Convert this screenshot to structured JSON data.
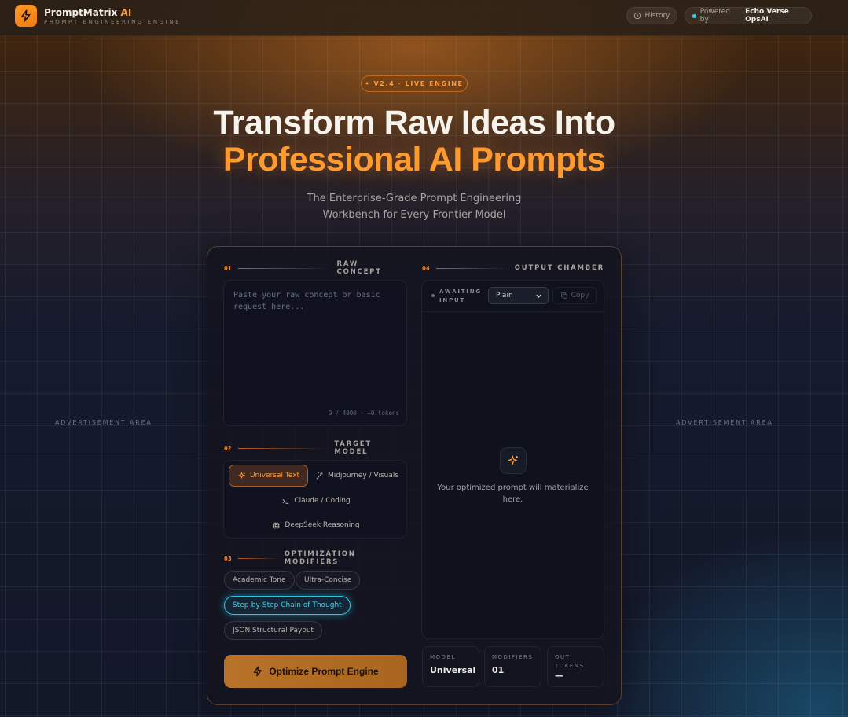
{
  "header": {
    "brand_main": "PromptMatrix",
    "brand_accent": "AI",
    "tagline": "PROMPT ENGINEERING ENGINE",
    "history_label": "History",
    "powered_prefix": "Powered by",
    "powered_name": "Echo Verse OpsAI"
  },
  "hero": {
    "badge": "• V2.4 · LIVE ENGINE",
    "title_line1": "Transform Raw Ideas Into",
    "title_line2": "Professional AI Prompts",
    "subtitle_line1": "The Enterprise-Grade Prompt Engineering",
    "subtitle_line2": "Workbench for Every Frontier Model"
  },
  "ads": {
    "left": "ADVERTISEMENT AREA",
    "right": "ADVERTISEMENT AREA"
  },
  "sections": {
    "s1_num": "01",
    "s1_label": "RAW CONCEPT",
    "s2_num": "02",
    "s2_label": "TARGET MODEL",
    "s3_num": "03",
    "s3_label": "OPTIMIZATION MODIFIERS",
    "s4_num": "04",
    "s4_label": "OUTPUT CHAMBER"
  },
  "concept": {
    "value": "",
    "placeholder": "Paste your raw concept or basic request here...",
    "counter": "0 / 4000 · ~0 tokens"
  },
  "models": [
    {
      "label": "Universal Text",
      "icon": "sparkles-icon",
      "active": true
    },
    {
      "label": "Midjourney / Visuals",
      "icon": "magic-wand-icon",
      "active": false
    },
    {
      "label": "Claude / Coding",
      "icon": "terminal-icon",
      "active": false
    },
    {
      "label": "DeepSeek Reasoning",
      "icon": "cpu-chip-icon",
      "active": false
    }
  ],
  "modifiers": [
    {
      "label": "Academic Tone",
      "active": false
    },
    {
      "label": "Ultra-Concise",
      "active": false
    },
    {
      "label": "Step-by-Step Chain of Thought",
      "active": true
    },
    {
      "label": "JSON Structural Payout",
      "active": false
    }
  ],
  "optimize_label": "Optimize Prompt Engine",
  "output": {
    "status_line1": "AWAITING",
    "status_line2": "INPUT",
    "format_selected": "Plain",
    "copy_label": "Copy",
    "placeholder_msg": "Your optimized prompt will materialize here."
  },
  "stats": [
    {
      "key": "MODEL",
      "value": "Universal"
    },
    {
      "key": "MODIFIERS",
      "value": "01"
    },
    {
      "key": "OUT TOKENS",
      "value": "—"
    }
  ],
  "colors": {
    "accent": "#ff9a2e",
    "cyan": "#2bc6e6"
  }
}
